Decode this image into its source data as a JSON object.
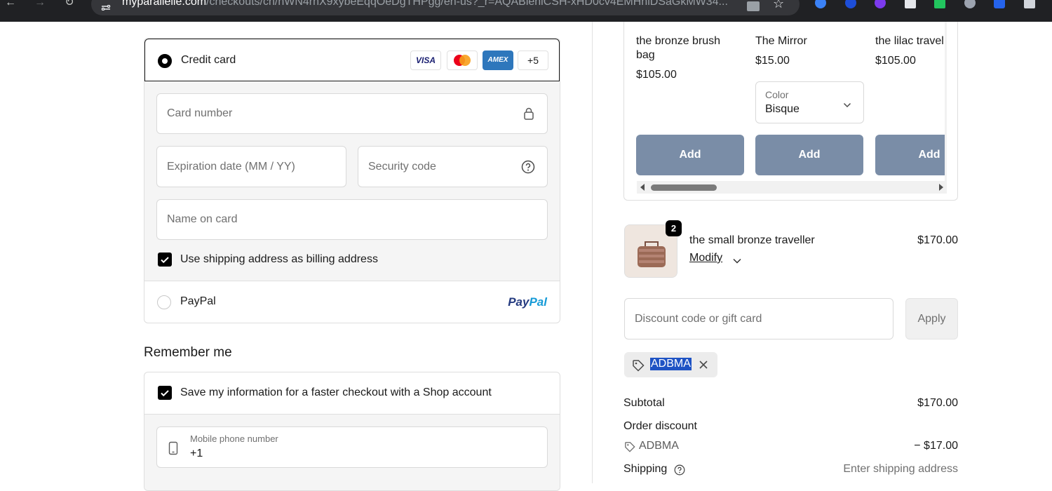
{
  "browser": {
    "url_domain": "myparallelle.com",
    "url_rest": "/checkouts/cn/hWN4rhX9xybeEqqOeDgTHPgg/en-us?_r=AQABleniCSH-xHD0cv4EMHhiDSaGkMW34..."
  },
  "payment": {
    "credit_card": {
      "label": "Credit card",
      "logos": {
        "visa": "VISA",
        "amex": "AMEX",
        "more": "+5"
      },
      "card_number_placeholder": "Card number",
      "expiration_placeholder": "Expiration date (MM / YY)",
      "security_code_placeholder": "Security code",
      "name_on_card_placeholder": "Name on card",
      "billing_checkbox_label": "Use shipping address as billing address"
    },
    "paypal": {
      "label": "PayPal",
      "logo_text_a": "Pay",
      "logo_text_b": "Pal"
    }
  },
  "remember": {
    "title": "Remember me",
    "save_label": "Save my information for a faster checkout with a Shop account",
    "phone_label": "Mobile phone number",
    "phone_value": "+1"
  },
  "upsell": {
    "items": [
      {
        "name_line1": "the bronze brush",
        "name_line2": "bag",
        "price": "$105.00",
        "button": "Add"
      },
      {
        "name_line1": "The Mirror",
        "price": "$15.00",
        "button": "Add",
        "color_label": "Color",
        "color_value": "Bisque"
      },
      {
        "name_line1": "the lilac travel",
        "price": "$105.00",
        "button": "Add"
      }
    ]
  },
  "cart": {
    "item_name": "the small bronze traveller",
    "item_qty": "2",
    "item_price": "$170.00",
    "modify_label": "Modify"
  },
  "discount": {
    "placeholder": "Discount code or gift card",
    "apply_label": "Apply",
    "applied_code": "ADBMA"
  },
  "summary": {
    "subtotal_label": "Subtotal",
    "subtotal_value": "$170.00",
    "order_discount_label": "Order discount",
    "discount_code": "ADBMA",
    "discount_value": "− $17.00",
    "shipping_label": "Shipping",
    "shipping_value": "Enter shipping address"
  },
  "colors": {
    "add_button": "#7a8da7",
    "selected_code_highlight": "#1f53c4"
  }
}
